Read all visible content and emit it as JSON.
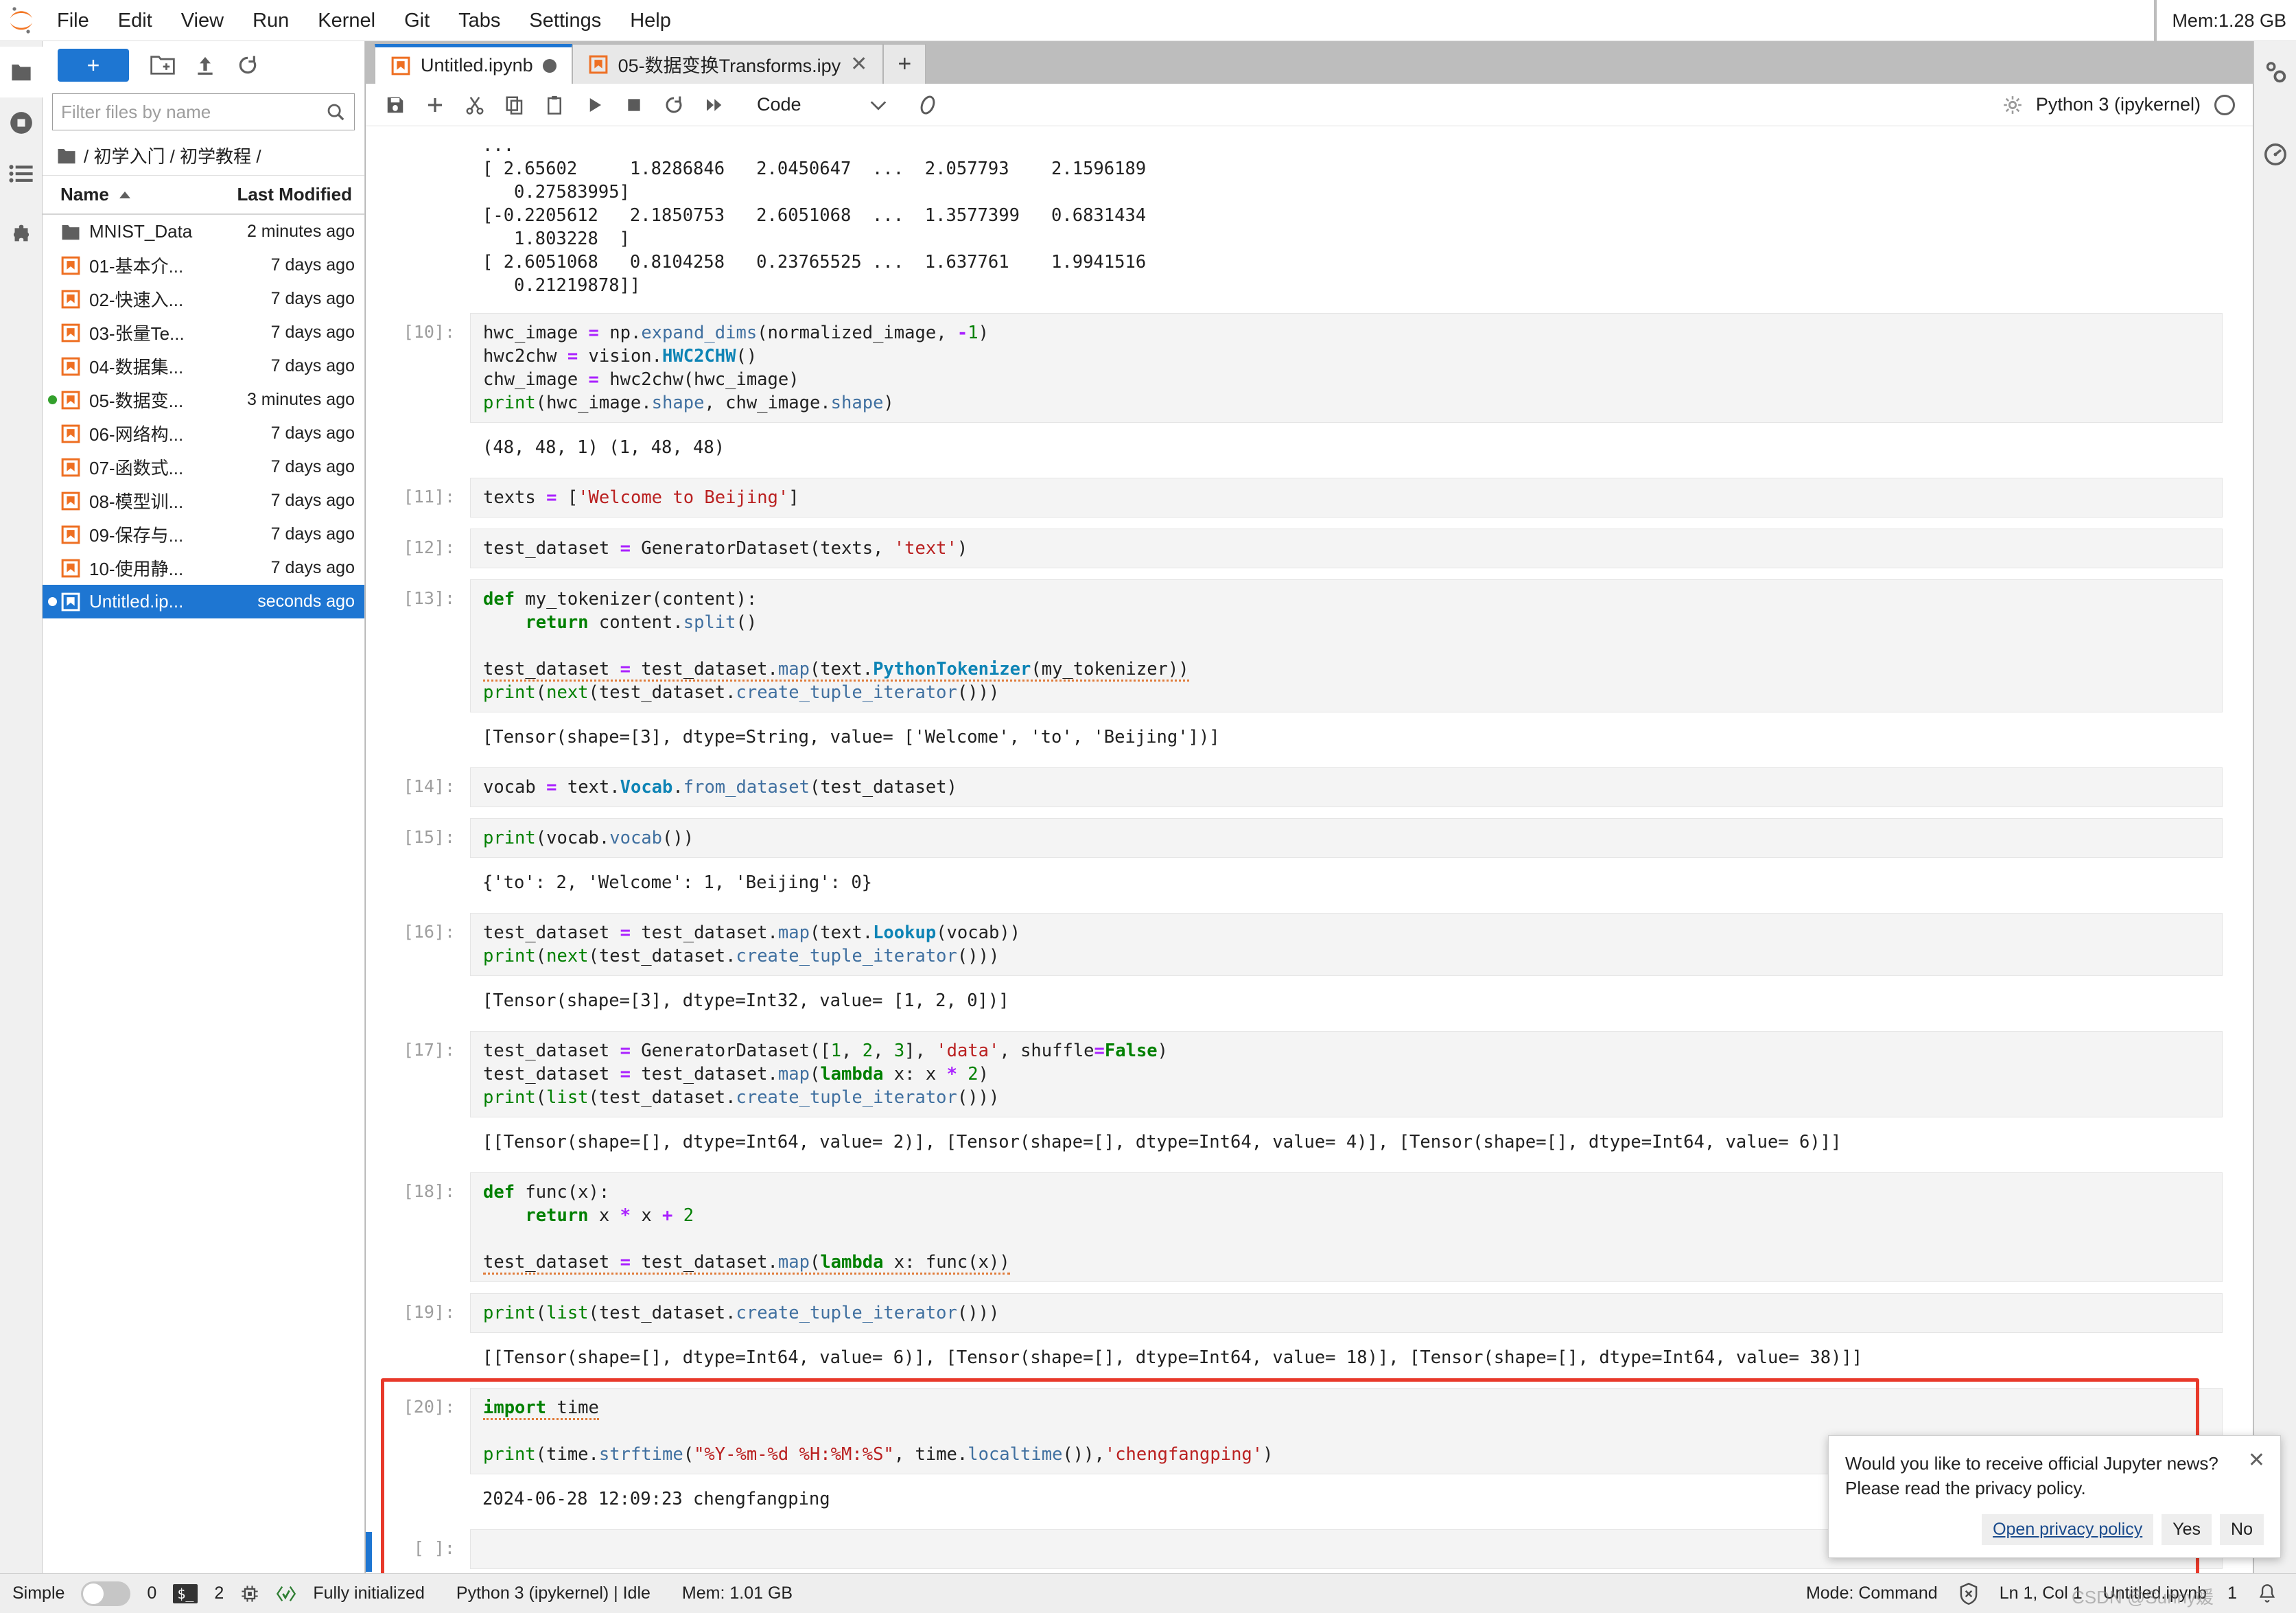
{
  "window": {
    "mem_top": "Mem:1.28 GB"
  },
  "menubar": {
    "items": [
      "File",
      "Edit",
      "View",
      "Run",
      "Kernel",
      "Git",
      "Tabs",
      "Settings",
      "Help"
    ]
  },
  "activitybar": {
    "items": [
      {
        "name": "file-browser-icon",
        "label": "File Browser"
      },
      {
        "name": "running-terminals-icon",
        "label": "Running Terminals and Kernels"
      },
      {
        "name": "table-of-contents-icon",
        "label": "Table of Contents"
      },
      {
        "name": "extension-manager-icon",
        "label": "Extension Manager"
      }
    ]
  },
  "filebrowser": {
    "new_launcher_label": "+",
    "toolbar_icons": [
      "new-folder-icon",
      "upload-icon",
      "refresh-icon"
    ],
    "filter": {
      "placeholder": "Filter files by name",
      "value": ""
    },
    "breadcrumb": "/ 初学入门 / 初学教程 /",
    "columns": {
      "name": "Name",
      "last_modified": "Last Modified"
    },
    "items": [
      {
        "name": "MNIST_Data",
        "modified": "2 minutes ago",
        "icon": "folder-icon",
        "status": "none",
        "selected": false
      },
      {
        "name": "01-基本介...",
        "modified": "7 days ago",
        "icon": "notebook-icon",
        "status": "none",
        "selected": false
      },
      {
        "name": "02-快速入...",
        "modified": "7 days ago",
        "icon": "notebook-icon",
        "status": "none",
        "selected": false
      },
      {
        "name": "03-张量Te...",
        "modified": "7 days ago",
        "icon": "notebook-icon",
        "status": "none",
        "selected": false
      },
      {
        "name": "04-数据集...",
        "modified": "7 days ago",
        "icon": "notebook-icon",
        "status": "none",
        "selected": false
      },
      {
        "name": "05-数据变...",
        "modified": "3 minutes ago",
        "icon": "notebook-icon",
        "status": "running",
        "selected": false
      },
      {
        "name": "06-网络构...",
        "modified": "7 days ago",
        "icon": "notebook-icon",
        "status": "none",
        "selected": false
      },
      {
        "name": "07-函数式...",
        "modified": "7 days ago",
        "icon": "notebook-icon",
        "status": "none",
        "selected": false
      },
      {
        "name": "08-模型训...",
        "modified": "7 days ago",
        "icon": "notebook-icon",
        "status": "none",
        "selected": false
      },
      {
        "name": "09-保存与...",
        "modified": "7 days ago",
        "icon": "notebook-icon",
        "status": "none",
        "selected": false
      },
      {
        "name": "10-使用静...",
        "modified": "7 days ago",
        "icon": "notebook-icon",
        "status": "none",
        "selected": false
      },
      {
        "name": "Untitled.ip...",
        "modified": "seconds ago",
        "icon": "notebook-icon",
        "status": "open",
        "selected": true
      }
    ]
  },
  "tabs": [
    {
      "label": "Untitled.ipynb",
      "active": true,
      "dirty": true
    },
    {
      "label": "05-数据变换Transforms.ipy",
      "active": false,
      "closable": true
    }
  ],
  "notebook_toolbar": {
    "buttons": [
      "save-icon",
      "insert-cell-icon",
      "cut-icon",
      "copy-icon",
      "paste-icon",
      "run-icon",
      "stop-icon",
      "restart-icon",
      "restart-run-all-icon"
    ],
    "cell_type": "Code",
    "extra_icon": "mindspore-icon",
    "kernel_name": "Python 3 (ipykernel)",
    "kernel_status": "idle"
  },
  "notebook": {
    "top_output": "...\n[ 2.65602     1.8286846   2.0450647  ...  2.057793    2.1596189\n   0.27583995]\n[-0.2205612   2.1850753   2.6051068  ...  1.3577399   0.6831434\n   1.803228  ]\n[ 2.6051068   0.8104258   0.23765525 ...  1.637761    1.9941516\n   0.21219878]]",
    "cells": [
      {
        "prompt": "[10]:",
        "code_lines": [
          "hwc_image = np.expand_dims(normalized_image, -1)",
          "hwc2chw = vision.HWC2CHW()",
          "chw_image = hwc2chw(hwc_image)",
          "print(hwc_image.shape, chw_image.shape)"
        ],
        "output": "(48, 48, 1) (1, 48, 48)"
      },
      {
        "prompt": "[11]:",
        "code_lines": [
          "texts = ['Welcome to Beijing']"
        ],
        "output": ""
      },
      {
        "prompt": "[12]:",
        "code_lines": [
          "test_dataset = GeneratorDataset(texts, 'text')"
        ],
        "output": ""
      },
      {
        "prompt": "[13]:",
        "code_lines": [
          "def my_tokenizer(content):",
          "    return content.split()",
          "",
          "test_dataset = test_dataset.map(text.PythonTokenizer(my_tokenizer))",
          "print(next(test_dataset.create_tuple_iterator()))"
        ],
        "output": "[Tensor(shape=[3], dtype=String, value= ['Welcome', 'to', 'Beijing'])]"
      },
      {
        "prompt": "[14]:",
        "code_lines": [
          "vocab = text.Vocab.from_dataset(test_dataset)"
        ],
        "output": ""
      },
      {
        "prompt": "[15]:",
        "code_lines": [
          "print(vocab.vocab())"
        ],
        "output": "{'to': 2, 'Welcome': 1, 'Beijing': 0}"
      },
      {
        "prompt": "[16]:",
        "code_lines": [
          "test_dataset = test_dataset.map(text.Lookup(vocab))",
          "print(next(test_dataset.create_tuple_iterator()))"
        ],
        "output": "[Tensor(shape=[3], dtype=Int32, value= [1, 2, 0])]"
      },
      {
        "prompt": "[17]:",
        "code_lines": [
          "test_dataset = GeneratorDataset([1, 2, 3], 'data', shuffle=False)",
          "test_dataset = test_dataset.map(lambda x: x * 2)",
          "print(list(test_dataset.create_tuple_iterator()))"
        ],
        "output": "[[Tensor(shape=[], dtype=Int64, value= 2)], [Tensor(shape=[], dtype=Int64, value= 4)], [Tensor(shape=[], dtype=Int64, value= 6)]]"
      },
      {
        "prompt": "[18]:",
        "code_lines": [
          "def func(x):",
          "    return x * x + 2",
          "",
          "test_dataset = test_dataset.map(lambda x: func(x))"
        ],
        "output": ""
      },
      {
        "prompt": "[19]:",
        "code_lines": [
          "print(list(test_dataset.create_tuple_iterator()))"
        ],
        "output": "[[Tensor(shape=[], dtype=Int64, value= 6)], [Tensor(shape=[], dtype=Int64, value= 18)], [Tensor(shape=[], dtype=Int64, value= 38)]]"
      },
      {
        "prompt": "[20]:",
        "code_lines": [
          "import time",
          "",
          "print(time.strftime(\"%Y-%m-%d %H:%M:%S\", time.localtime()),'chengfangping')"
        ],
        "output": "2024-06-28 12:09:23 chengfangping"
      },
      {
        "prompt": "[ ]:",
        "code_lines": [
          ""
        ],
        "output": ""
      }
    ]
  },
  "notification": {
    "message_line1": "Would you like to receive official Jupyter news?",
    "message_line2": "Please read the privacy policy.",
    "link_label": "Open privacy policy",
    "yes_label": "Yes",
    "no_label": "No",
    "close_label": "✕"
  },
  "statusbar": {
    "simple_label": "Simple",
    "simple_on": false,
    "terminals_count": "0",
    "kernels_count": "2",
    "init_status": "Fully initialized",
    "kernel_info": "Python 3 (ipykernel) | Idle",
    "memory": "Mem: 1.01 GB",
    "mode": "Mode: Command",
    "cursor": "Ln 1, Col 1",
    "filename": "Untitled.ipynb",
    "notification_count": "1"
  },
  "rightbar": {
    "items": [
      {
        "name": "property-inspector-icon"
      },
      {
        "name": "debugger-icon"
      }
    ]
  },
  "watermark": "CSDN @Sunny媛",
  "colors": {
    "accent": "#1e76d2",
    "active_cell_border": "#e8392a",
    "notebook_orange": "#ee6f22",
    "running_green": "#33a02c"
  }
}
